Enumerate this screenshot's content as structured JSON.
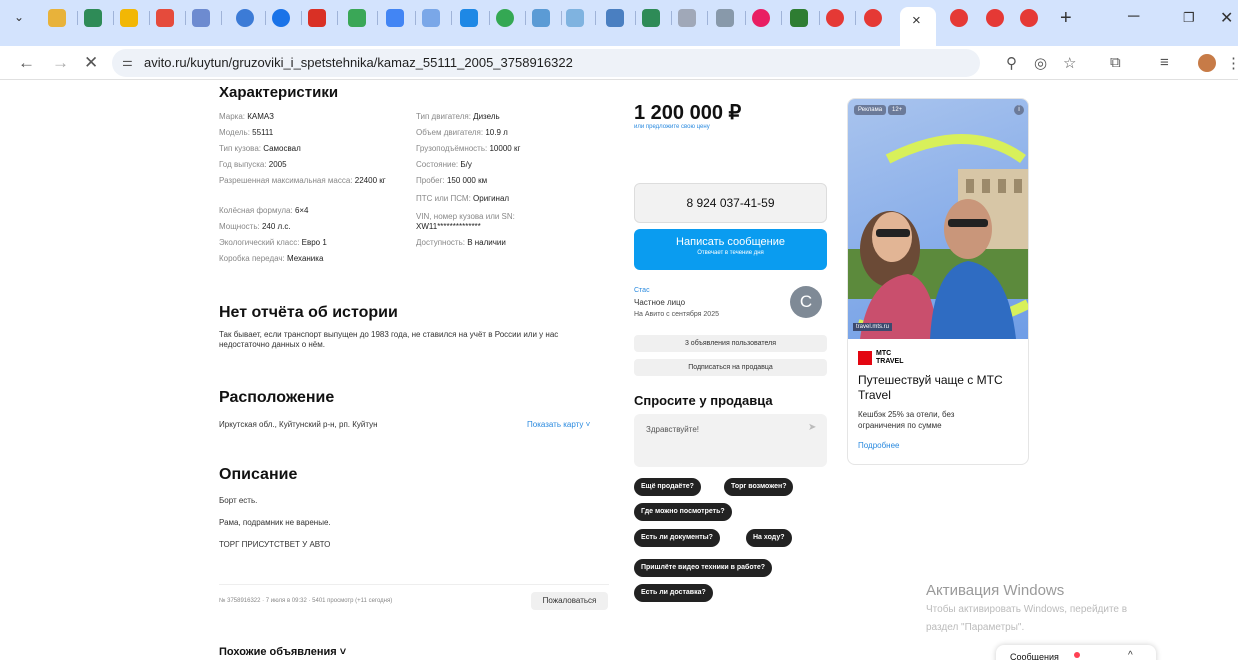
{
  "browser": {
    "url": "avito.ru/kuytun/gruzoviki_i_spetstehnika/kamaz_55111_2005_3758916322",
    "tab_close": "×",
    "new_tab": "+"
  },
  "specs": {
    "heading": "Характеристики",
    "left": [
      {
        "label": "Марка: ",
        "value": "КАМАЗ"
      },
      {
        "label": "Модель: ",
        "value": "55111"
      },
      {
        "label": "Тип кузова: ",
        "value": "Самосвал"
      },
      {
        "label": "Год выпуска: ",
        "value": "2005"
      },
      {
        "label": "Разрешенная максимальная масса: ",
        "value": "22400 кг"
      },
      {
        "label": "Колёсная формула: ",
        "value": "6×4"
      },
      {
        "label": "Мощность: ",
        "value": "240 л.с."
      },
      {
        "label": "Экологический класс: ",
        "value": "Евро 1"
      },
      {
        "label": "Коробка передач: ",
        "value": "Механика"
      }
    ],
    "right": [
      {
        "label": "Тип двигателя: ",
        "value": "Дизель"
      },
      {
        "label": "Объем двигателя: ",
        "value": "10.9 л"
      },
      {
        "label": "Грузоподъёмность: ",
        "value": "10000 кг"
      },
      {
        "label": "Состояние: ",
        "value": "Б/у"
      },
      {
        "label": "Пробег: ",
        "value": "150 000 км"
      },
      {
        "label": "ПТС или ПСМ: ",
        "value": "Оригинал"
      },
      {
        "label": "VIN, номер кузова или SN: ",
        "value": "XW11**************"
      },
      {
        "label": "Доступность: ",
        "value": "В наличии"
      }
    ]
  },
  "history": {
    "heading": "Нет отчёта об истории",
    "text": "Так бывает, если транспорт выпущен до 1983 года, не ставился на учёт в России или у нас недостаточно данных о нём."
  },
  "location": {
    "heading": "Расположение",
    "address": "Иркутская обл., Куйтунский р-н, рп. Куйтун",
    "map_link": "Показать карту ˅"
  },
  "description": {
    "heading": "Описание",
    "lines": [
      "Борт есть.",
      "Рама, подрамник не вареные.",
      "ТОРГ ПРИСУТСТВЕТ У АВТО"
    ]
  },
  "meta": {
    "text": "№ 3758916322 · 7 июля в 09:32 · 5401 просмотр (+11 сегодня)",
    "report_button": "Пожаловаться"
  },
  "similar": {
    "label": "Похожие объявления ˅"
  },
  "price": {
    "value": "1 200 000 ₽",
    "offer_link": "или предложите свою цену"
  },
  "contact": {
    "phone": "8 924 037-41-59",
    "write_button": "Написать сообщение",
    "write_sub": "Отвечает в течение дня"
  },
  "seller": {
    "name": "Стас",
    "type": "Частное лицо",
    "since": "На Авито с сентября 2025",
    "avatar_letter": "С",
    "listings_button": "3 объявления пользователя",
    "subscribe_button": "Подписаться на продавца"
  },
  "ask": {
    "heading": "Спросите у продавца",
    "input_value": "Здравствуйте!",
    "send_icon": "➤",
    "chips": [
      "Ещё продаёте?",
      "Торг возможен?",
      "Где можно посмотреть?",
      "Есть ли документы?",
      "На ходу?",
      "Пришлёте видео техники в работе?",
      "Есть ли доставка?"
    ]
  },
  "ad": {
    "badge": "Реклама",
    "age": "12+",
    "domain": "travel.mts.ru",
    "brand_line1": "МТС",
    "brand_line2": "TRAVEL",
    "title": "Путешествуй чаще с МТС Travel",
    "text": "Кешбэк 25% за отели, без ограничения по сумме",
    "link": "Подробнее"
  },
  "activation": {
    "title": "Активация Windows",
    "line1": "Чтобы активировать Windows, перейдите в",
    "line2": "раздел \"Параметры\"."
  },
  "messages": {
    "label": "Сообщения",
    "chevron": "^"
  }
}
